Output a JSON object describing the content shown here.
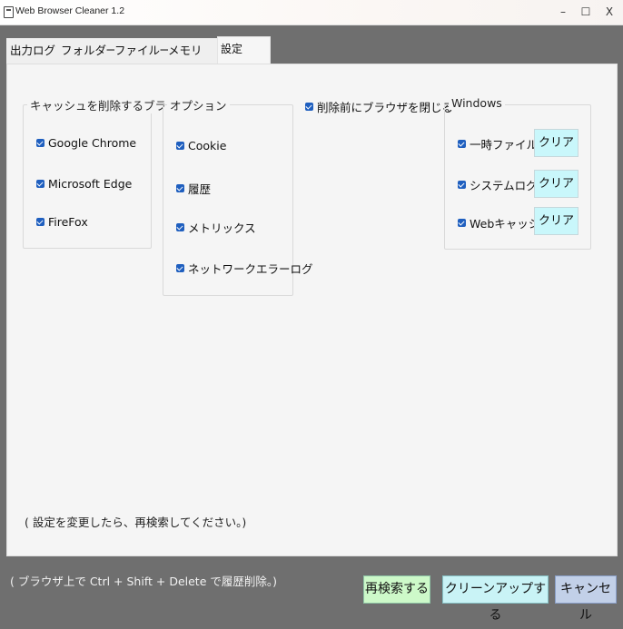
{
  "window": {
    "title": "Web Browser Cleaner 1.2",
    "minimize": "–",
    "maximize": "☐",
    "close": "X"
  },
  "tabs": [
    {
      "label": "出力ログ",
      "active": false
    },
    {
      "label": "フォルダ一覧",
      "active": false
    },
    {
      "label": "ファイル一覧",
      "active": false
    },
    {
      "label": "メモリ",
      "active": false
    },
    {
      "label": "設定",
      "active": true
    }
  ],
  "browsers": {
    "title": "キャッシュを削除するブラウザ",
    "items": [
      {
        "label": "Google Chrome",
        "checked": true
      },
      {
        "label": "Microsoft Edge",
        "checked": true
      },
      {
        "label": "FireFox",
        "checked": true
      }
    ]
  },
  "options": {
    "title": "オプション",
    "items": [
      {
        "label": "Cookie",
        "checked": true
      },
      {
        "label": "履歴",
        "checked": true
      },
      {
        "label": "メトリックス",
        "checked": true
      },
      {
        "label": "ネットワークエラーログ",
        "checked": true
      }
    ]
  },
  "close_browser": {
    "label": "削除前にブラウザを閉じる",
    "checked": true
  },
  "windows": {
    "title": "Windows",
    "items": [
      {
        "label": "一時ファイル",
        "checked": true,
        "button": "クリア"
      },
      {
        "label": "システムログ",
        "checked": true,
        "button": "クリア"
      },
      {
        "label": "Webキャッシュ",
        "checked": true,
        "button": "クリア"
      }
    ]
  },
  "settings_hint": "( 設定を変更したら、再検索してください。)",
  "footer": {
    "hint": "( ブラウザ上で Ctrl + Shift + Delete で履歴削除。)",
    "research": "再検索する",
    "cleanup": "クリーンアップする",
    "cancel": "キャンセル"
  },
  "colors": {
    "checkbox": "#1f5fbf",
    "clear_button": "#c9f7fb",
    "research_button": "#cdf9c9",
    "cleanup_button": "#c9f3f6",
    "cancel_button": "#c2d0e8"
  }
}
